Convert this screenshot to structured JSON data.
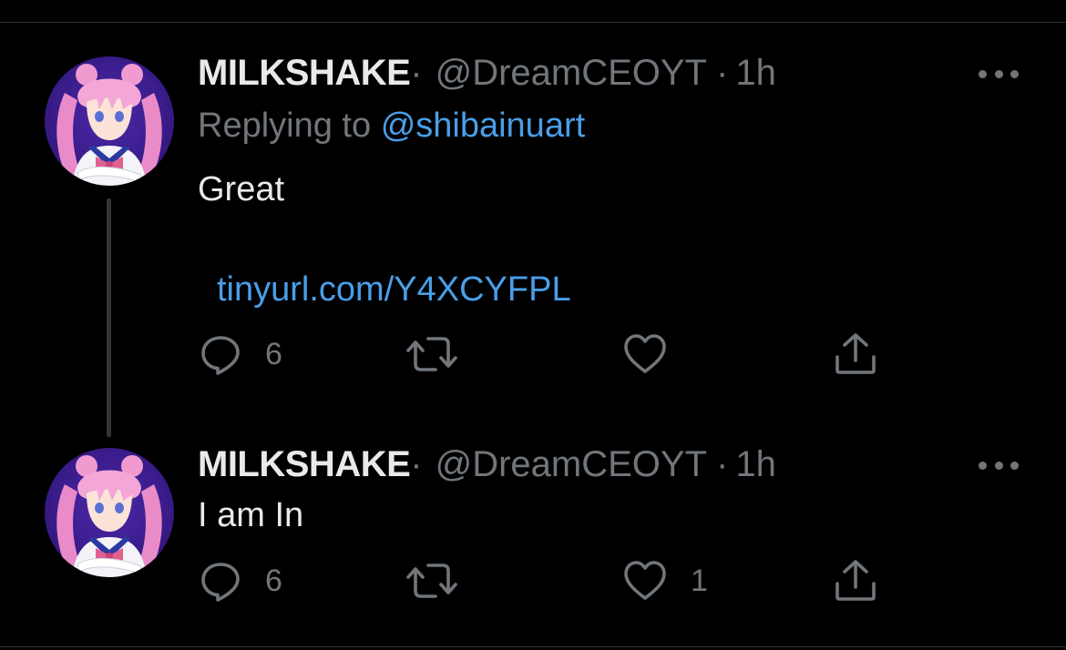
{
  "colors": {
    "background": "#000000",
    "text_primary": "#e7e9ea",
    "text_secondary": "#71767b",
    "link": "#4a9ee8",
    "divider": "#2f3336"
  },
  "tweets": [
    {
      "display_name": "MILKSHAKE",
      "name_dot": "·",
      "handle": "@DreamCEOYT",
      "separator": "·",
      "time": "1h",
      "replying_prefix": "Replying to",
      "replying_to": "@shibainuart",
      "text": "Great",
      "link": "tinyurl.com/Y4XCYFPL",
      "avatar_icon": "avatar-anime-girl-icon",
      "more_icon": "more-options-icon",
      "actions": {
        "reply": {
          "icon": "reply-icon",
          "count": "6"
        },
        "retweet": {
          "icon": "retweet-icon",
          "count": ""
        },
        "like": {
          "icon": "heart-icon",
          "count": ""
        },
        "share": {
          "icon": "share-icon",
          "count": ""
        }
      }
    },
    {
      "display_name": "MILKSHAKE",
      "name_dot": "·",
      "handle": "@DreamCEOYT",
      "separator": "·",
      "time": "1h",
      "text": "I am In",
      "avatar_icon": "avatar-anime-girl-icon",
      "more_icon": "more-options-icon",
      "actions": {
        "reply": {
          "icon": "reply-icon",
          "count": "6"
        },
        "retweet": {
          "icon": "retweet-icon",
          "count": ""
        },
        "like": {
          "icon": "heart-icon",
          "count": "1"
        },
        "share": {
          "icon": "share-icon",
          "count": ""
        }
      }
    }
  ]
}
